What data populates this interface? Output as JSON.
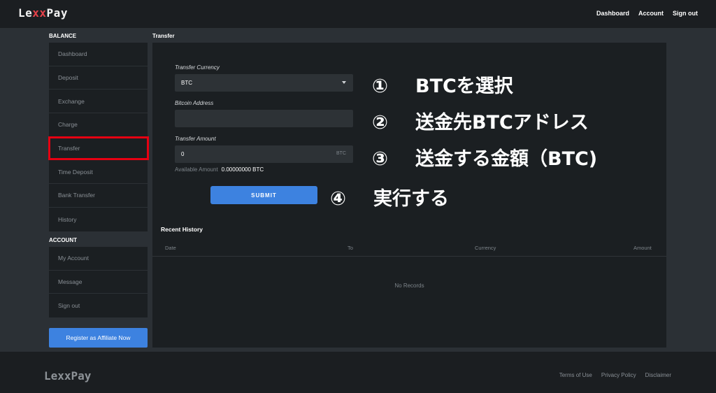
{
  "header": {
    "logo": "LexxPay",
    "nav": [
      "Dashboard",
      "Account",
      "Sign out"
    ]
  },
  "sidebar": {
    "balance_label": "BALANCE",
    "balance_items": [
      "Dashboard",
      "Deposit",
      "Exchange",
      "Charge",
      "Transfer",
      "Time Deposit",
      "Bank Transfer",
      "History"
    ],
    "account_label": "ACCOUNT",
    "account_items": [
      "My Account",
      "Message",
      "Sign out"
    ],
    "affiliate_button": "Register as Affiliate Now",
    "highlight_color": "#e60012"
  },
  "main": {
    "title": "Transfer",
    "form": {
      "currency_label": "Transfer Currency",
      "currency_value": "BTC",
      "address_label": "Bitcoin Address",
      "address_value": "",
      "amount_label": "Transfer Amount",
      "amount_value": "0",
      "amount_unit": "BTC",
      "available_label": "Available Amount",
      "available_value": "0.00000000 BTC",
      "submit": "SUBMIT"
    },
    "annotations": [
      {
        "num": "①",
        "text": "BTCを選択"
      },
      {
        "num": "②",
        "text": "送金先BTCアドレス"
      },
      {
        "num": "③",
        "text": "送金する金額（BTC)"
      },
      {
        "num": "④",
        "text": "実行する"
      }
    ],
    "recent_history": {
      "title": "Recent History",
      "columns": [
        "Date",
        "To",
        "Currency",
        "Amount"
      ],
      "empty_text": "No Records"
    }
  },
  "footer": {
    "logo": "LexxPay",
    "links": [
      "Terms of Use",
      "Privacy Policy",
      "Disclaimer"
    ]
  },
  "colors": {
    "accent": "#3d82e0",
    "background": "#2b3035",
    "panel": "#1b1f22"
  }
}
